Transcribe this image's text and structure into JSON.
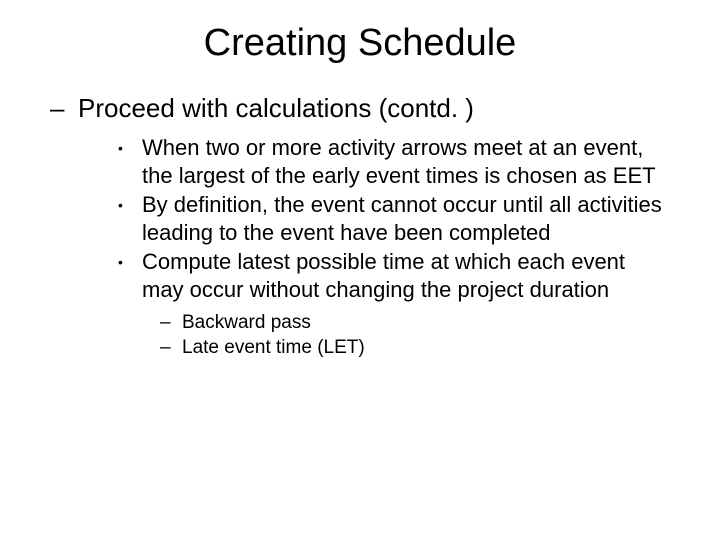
{
  "title": "Creating Schedule",
  "level1": {
    "dash": "–",
    "text": "Proceed with calculations (contd. )"
  },
  "level2": [
    "When two or more activity arrows meet at an event, the largest of the early event times is chosen as EET",
    "By definition, the event cannot occur until all activities leading to the event have been completed",
    "Compute latest possible time at which each event may occur without changing the project duration"
  ],
  "bullet": "•",
  "level3": [
    "Backward pass",
    "Late event time (LET)"
  ],
  "dash3": "–"
}
